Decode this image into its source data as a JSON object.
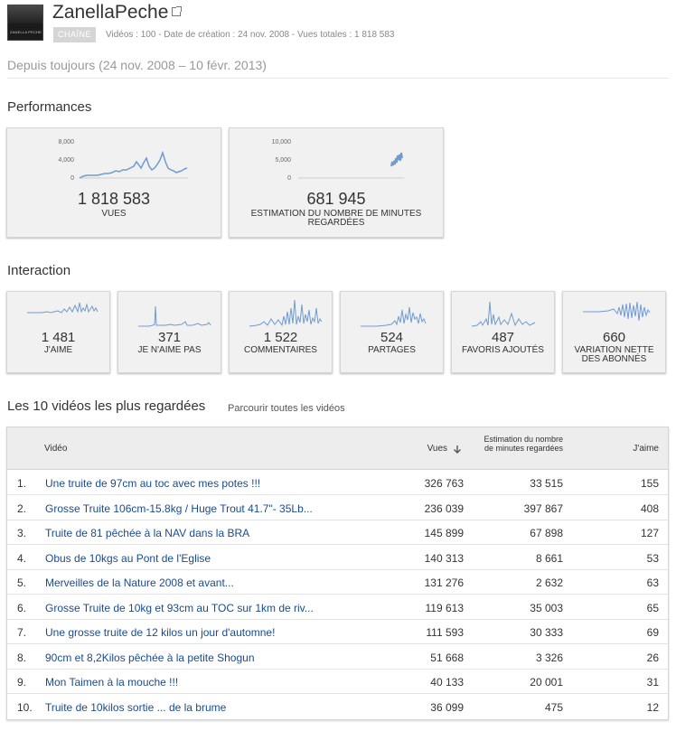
{
  "channel": {
    "name": "ZanellaPeche",
    "badge": "CHAÎNE",
    "meta": "Vidéos : 100  -  Date de création : 24 nov. 2008  -  Vues totales : 1 818 583",
    "avatar_text": "ZANELLA PECHE"
  },
  "period": "Depuis toujours (24 nov. 2008 – 10 févr. 2013)",
  "performance": {
    "title": "Performances",
    "cards": [
      {
        "value": "1 818 583",
        "label": "VUES",
        "ticks": [
          "8,000",
          "4,000",
          "0"
        ]
      },
      {
        "value": "681 945",
        "label": "ESTIMATION DU NOMBRE DE MINUTES REGARDÉES",
        "ticks": [
          "10,000",
          "5,000",
          "0"
        ]
      }
    ]
  },
  "interaction": {
    "title": "Interaction",
    "cards": [
      {
        "value": "1 481",
        "label": "J'AIME"
      },
      {
        "value": "371",
        "label": "JE N'AIME PAS"
      },
      {
        "value": "1 522",
        "label": "COMMENTAIRES"
      },
      {
        "value": "524",
        "label": "PARTAGES"
      },
      {
        "value": "487",
        "label": "FAVORIS AJOUTÉS"
      },
      {
        "value": "660",
        "label": "VARIATION NETTE DES ABONNÉS"
      }
    ]
  },
  "top_videos": {
    "title": "Les 10 vidéos les plus regardées",
    "browse_link": "Parcourir toutes les vidéos",
    "headers": {
      "video": "Vidéo",
      "views": "Vues",
      "est_minutes": "Estimation du nombre de minutes regardées",
      "likes": "J'aime"
    },
    "rows": [
      {
        "idx": "1.",
        "title": "Une truite de 97cm au toc avec mes potes !!!",
        "views": "326 763",
        "minutes": "33 515",
        "likes": "155"
      },
      {
        "idx": "2.",
        "title": "Grosse Truite 106cm-15.8kg / Huge Trout 41.7\"- 35Lb...",
        "views": "236 039",
        "minutes": "397 867",
        "likes": "408"
      },
      {
        "idx": "3.",
        "title": "Truite de 81 pêchée à la NAV dans la BRA",
        "views": "145 899",
        "minutes": "67 898",
        "likes": "127"
      },
      {
        "idx": "4.",
        "title": "Obus de 10kgs au Pont de l'Eglise",
        "views": "140 313",
        "minutes": "8 661",
        "likes": "53"
      },
      {
        "idx": "5.",
        "title": "Merveilles de la Nature 2008 et avant...",
        "views": "131 276",
        "minutes": "2 632",
        "likes": "63"
      },
      {
        "idx": "6.",
        "title": "Grosse Truite de 10kg et 93cm au TOC sur 1km de riv...",
        "views": "119 613",
        "minutes": "35 003",
        "likes": "65"
      },
      {
        "idx": "7.",
        "title": "Une grosse truite de 12 kilos un jour d'automne!",
        "views": "111 593",
        "minutes": "30 333",
        "likes": "69"
      },
      {
        "idx": "8.",
        "title": "90cm et 8,2Kilos pêchée à la petite Shogun",
        "views": "51 668",
        "minutes": "3 326",
        "likes": "26"
      },
      {
        "idx": "9.",
        "title": "Mon Taimen à la mouche !!!",
        "views": "40 133",
        "minutes": "20 001",
        "likes": "31"
      },
      {
        "idx": "10.",
        "title": "Truite de 10kilos sortie ... de la brume",
        "views": "36 099",
        "minutes": "475",
        "likes": "12"
      }
    ]
  },
  "colors": {
    "spark": "#6f9bd1",
    "link": "#1a4b8f",
    "card_bg": "#f1f1f1"
  }
}
